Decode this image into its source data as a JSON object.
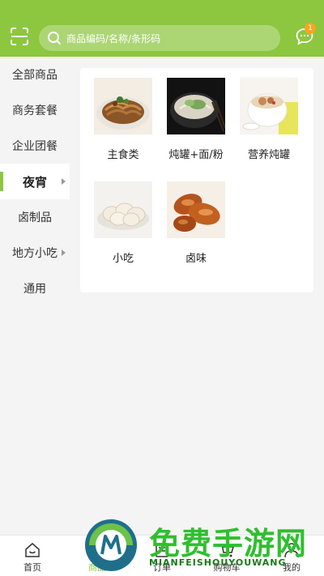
{
  "search": {
    "placeholder": "商品编码/名称/条形码"
  },
  "messages": {
    "badge_count": "1"
  },
  "sidebar": {
    "items": [
      {
        "label": "全部商品"
      },
      {
        "label": "商务套餐"
      },
      {
        "label": "企业团餐"
      },
      {
        "label": "夜宵",
        "active": true
      },
      {
        "label": "卤制品"
      },
      {
        "label": "地方小吃"
      },
      {
        "label": "通用"
      }
    ]
  },
  "categories": [
    {
      "label": "主食类"
    },
    {
      "label": "炖罐+面/粉"
    },
    {
      "label": "营养炖罐"
    },
    {
      "label": "小吃"
    },
    {
      "label": "卤味"
    }
  ],
  "bottom_nav": {
    "tabs": [
      {
        "label": "首页",
        "icon": "home-icon"
      },
      {
        "label": "商品",
        "icon": "goods-icon",
        "active": true
      },
      {
        "label": "订单",
        "icon": "order-icon"
      },
      {
        "label": "购物车",
        "icon": "cart-icon"
      },
      {
        "label": "我的",
        "icon": "profile-icon"
      }
    ]
  },
  "watermark": {
    "cn": "免费手游网",
    "en": "MIANFEISHOUYOUWANG"
  },
  "colors": {
    "brand": "#8dc63f",
    "badge": "#f5a623",
    "watermark": "#2fbf2f"
  }
}
